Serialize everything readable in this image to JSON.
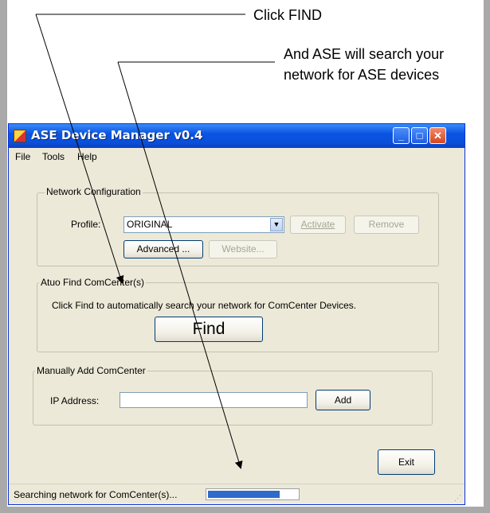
{
  "annotations": {
    "note1": "Click FIND",
    "note2_line1": "And ASE will search your",
    "note2_line2": "network for ASE devices"
  },
  "window": {
    "title": "ASE Device Manager v0.4",
    "controls": {
      "minimize": "_",
      "maximize": "□",
      "close": "✕"
    }
  },
  "menu": [
    "File",
    "Tools",
    "Help"
  ],
  "network_config": {
    "group_label": "Network Configuration",
    "profile_label": "Profile:",
    "profile_value": "ORIGINAL",
    "activate_label": "Activate",
    "remove_label": "Remove",
    "advanced_label": "Advanced ...",
    "website_label": "Website..."
  },
  "auto_find": {
    "group_label": "Atuo Find ComCenter(s)",
    "description": "Click Find to automatically search your network for ComCenter Devices.",
    "find_label": "Find"
  },
  "manual_add": {
    "group_label": "Manually Add ComCenter",
    "ip_label": "IP Address:",
    "ip_value": "",
    "add_label": "Add"
  },
  "exit_label": "Exit",
  "status": {
    "text": "Searching network for ComCenter(s)...",
    "progress": 0.8
  },
  "colors": {
    "title_bar": "#0a54e3",
    "window_bg": "#ece9d8",
    "progress_fill": "#2f6bc9"
  }
}
